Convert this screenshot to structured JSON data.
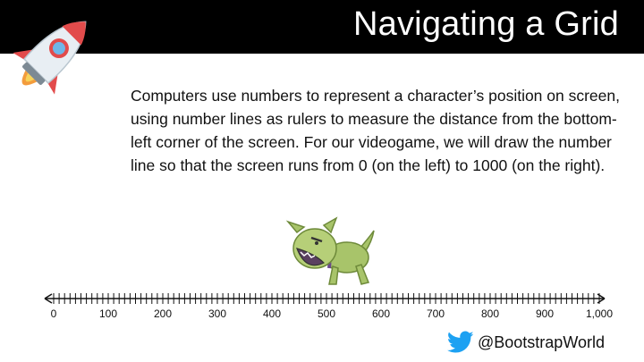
{
  "slide": {
    "title": "Navigating a Grid",
    "body": "Computers use numbers to represent a character’s position on screen, using number lines as rulers to measure the distance from the bottom-left corner of the screen. For our videogame, we will draw the number line so that the screen runs from 0 (on the left) to 1000 (on the right).",
    "footer_handle": "@BootstrapWorld"
  },
  "number_line": {
    "labels": [
      "0",
      "100",
      "200",
      "300",
      "400",
      "500",
      "600",
      "700",
      "800",
      "900",
      "1,000"
    ],
    "minor_tick_step": 10
  },
  "icons": {
    "rocket": "rocket-icon",
    "dog": "dog-character-icon",
    "twitter": "twitter-bird-icon"
  },
  "colors": {
    "title_bar": "#000000",
    "title_text": "#ffffff",
    "twitter_blue": "#1da1f2",
    "dog_green": "#a8c46a"
  }
}
